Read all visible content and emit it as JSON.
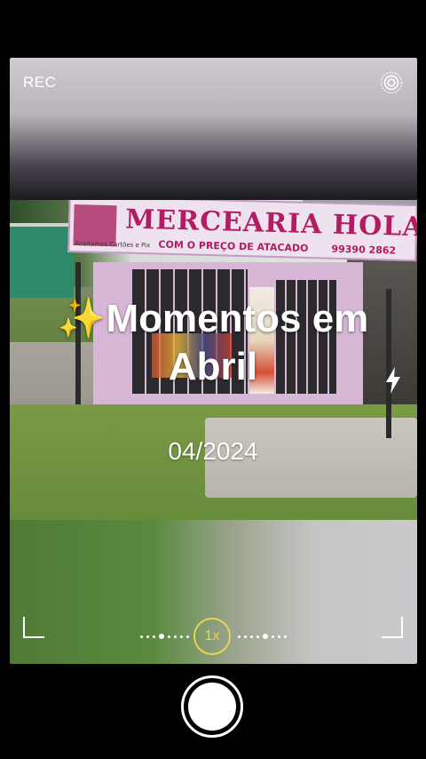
{
  "camera": {
    "rec_label": "REC",
    "zoom_label": "1x",
    "accent_color": "#e9d257"
  },
  "overlay": {
    "sparkles": "✨",
    "title_line1": "Momentos em",
    "title_line2": "Abril",
    "date": "04/2024"
  },
  "scene": {
    "shop_sign": "MERCEARIA HOLANDA",
    "shop_subtitle": "COM O PREÇO DE ATACADO",
    "shop_phone": "99390 2862",
    "shop_small": "Aceitamos Cartões e Pix"
  },
  "icons": {
    "settings": "live-photo-icon",
    "flash": "flash-icon",
    "shutter": "shutter-button"
  }
}
